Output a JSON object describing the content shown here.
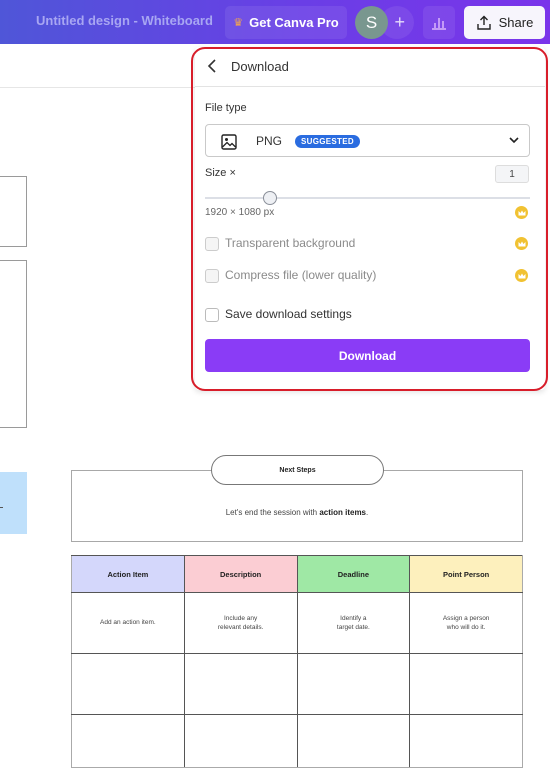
{
  "topbar": {
    "doc_title": "Untitled design - Whiteboard",
    "pro_button": "Get Canva Pro",
    "avatar_initial": "S",
    "add_label": "+",
    "share_label": "Share"
  },
  "download_panel": {
    "title": "Download",
    "file_type_label": "File type",
    "file_type_value": "PNG",
    "file_type_badge": "SUGGESTED",
    "size_label": "Size ×",
    "size_value": "1",
    "size_slider_fraction": 0.2,
    "dimensions": "1920 × 1080 px",
    "options": [
      {
        "label": "Transparent background",
        "checked": false,
        "pro": true,
        "enabled": false
      },
      {
        "label": "Compress file (lower quality)",
        "checked": false,
        "pro": true,
        "enabled": false
      },
      {
        "label": "Save download settings",
        "checked": false,
        "pro": false,
        "enabled": true
      }
    ],
    "download_button": "Download"
  },
  "canvas": {
    "section_title": "Next Steps",
    "section_text_prefix": "Let's end the session with ",
    "section_text_bold": "action items",
    "section_text_suffix": ".",
    "table": {
      "headers": [
        "Action Item",
        "Description",
        "Deadline",
        "Point Person"
      ],
      "header_colors": [
        "#d4d7fb",
        "#fbcdd3",
        "#9fe8a5",
        "#fdf0bd"
      ],
      "rows": [
        [
          "Add an action item.",
          "Include any\nrelevant details.",
          "Identify a\ntarget date.",
          "Assign a person\nwho will do it."
        ],
        [
          "",
          "",
          "",
          ""
        ],
        [
          "",
          "",
          "",
          ""
        ]
      ]
    }
  },
  "colors": {
    "accent": "#8a3cf6",
    "highlight_border": "#d81d2a",
    "badge": "#2a6ce0",
    "pro_crown": "#f1c232"
  }
}
